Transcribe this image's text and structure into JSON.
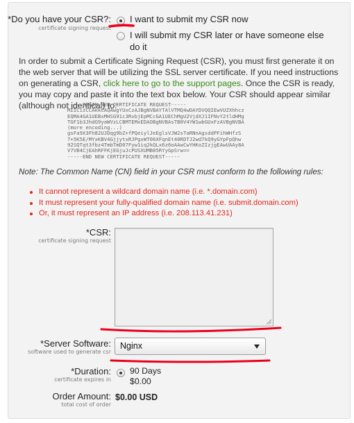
{
  "csr_question": {
    "label": "*Do you have your CSR?:",
    "sublabel": "certificate signing request",
    "options": [
      {
        "label": "I want to submit my CSR now",
        "checked": true
      },
      {
        "label_line1": "I will submit my CSR later or have someone else",
        "label_line2": "do it",
        "checked": false
      }
    ]
  },
  "intro": {
    "text_before_link": "In order to submit a Certificate Signing Request (CSR), you must first generate it on the web server that will be utilizing the SSL server certificate. If you need instructions on generating a CSR, ",
    "link_text": "click here to go to the support pages",
    "text_after_link": ". Once the CSR is ready, you may copy and paste it into the text box below. Your CSR should appear similar (although not identical) to:"
  },
  "csr_sample": [
    "-----BEGIN NEW CERTIFICATE REQUEST-----",
    "MIICizCCAkkCAQAwgYUxCzAJBgNVBAYTAlVTMQ4wDAYDVQQIEwVUZXhhcz",
    "EQMA4GA1UEBxMHSG91c3RvbjEpMCcGA1UEChMgU2VjdXJ1IFNvY2tldHMg",
    "TGF1b3JhdG9yaWVzLCBMTEMxEDAOBgNVBAsTB0V4YW1wbGUxFzAVBgNVBA",
    "(more encoding...)",
    "gsFa9X3Fh82UJDqg9bZ+fPQeiylJeEglsVJW2sTaRNnAgsddPFihWHfzS",
    "7+5K5E/MYxKBV4GjjytxRJPgxWT06XFqnEt40RDTJ2wd7kQ9yGYpFpQhw",
    "92SQTqt3fbz4TmbTmD07Fyw1iq2kQLx6z6oAAwCwYHKoZIzjgEAwUAAy8A",
    "V7VB4CjEAhRFFKjEGjuJcPUSXUMB85RYyGpSrw==",
    "-----END NEW CERTIFICATE REQUEST-----"
  ],
  "note": "Note: The Common Name (CN) field in your CSR must conform to the following rules:",
  "rules": [
    "It cannot represent a wildcard domain name (i.e. *.domain.com)",
    "It must represent your fully-qualified domain name (i.e. submit.domain.com)",
    "Or, it must represent an IP address (i.e. 208.113.41.231)"
  ],
  "csr_field": {
    "label": "*CSR:",
    "sublabel": "certificate signing request",
    "value": ""
  },
  "server_software": {
    "label": "*Server Software:",
    "sublabel": "software used to generate csr",
    "selected": "Nginx"
  },
  "duration": {
    "label": "*Duration:",
    "sublabel": "certificate expires in",
    "option": "90 Days",
    "price": "$0.00"
  },
  "order_amount": {
    "label": "Order Amount:",
    "sublabel": "total cost of order",
    "value": "$0.00 USD"
  },
  "colors": {
    "link": "#3a8a1f",
    "rule_text": "#e0271c",
    "annotation": "#e8001c"
  }
}
